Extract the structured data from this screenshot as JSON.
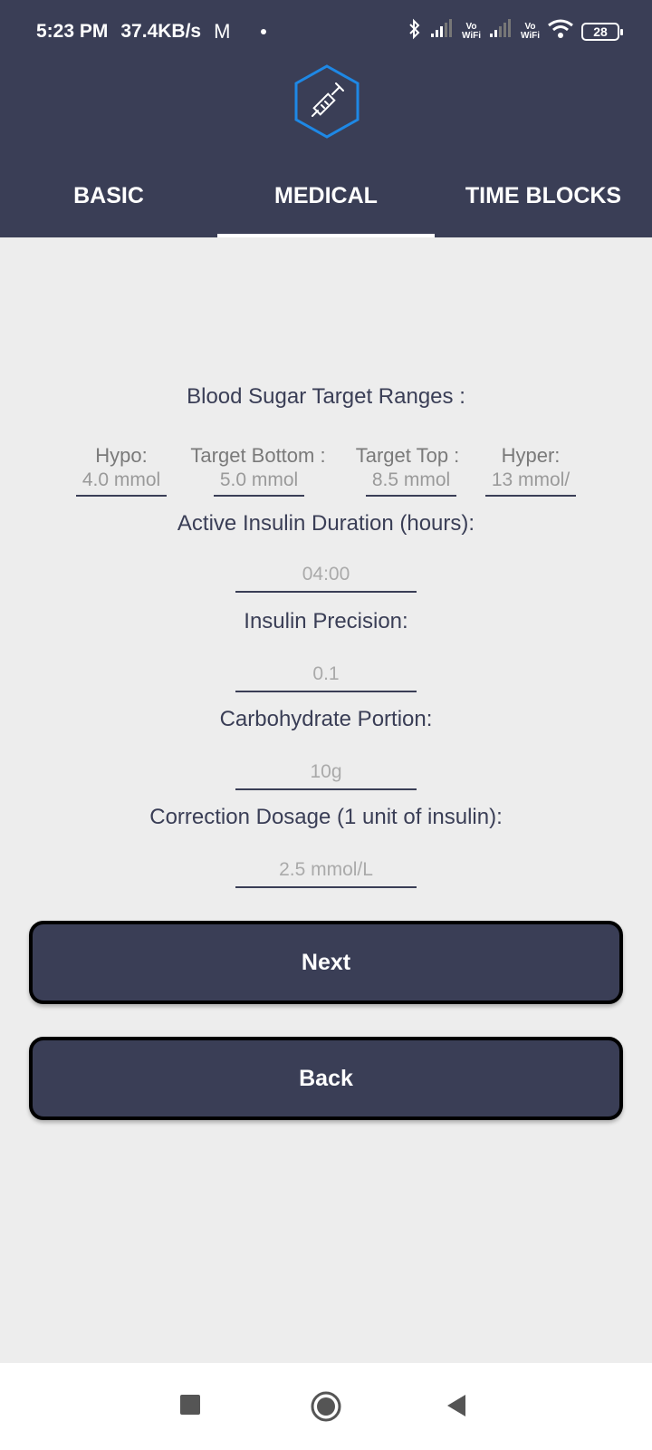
{
  "status_bar": {
    "time": "5:23 PM",
    "net_speed": "37.4KB/s",
    "mail_icon": "M",
    "vowifi_1_top": "Vo",
    "vowifi_1_bottom": "WiFi",
    "vowifi_2_top": "Vo",
    "vowifi_2_bottom": "WiFi",
    "battery": "28"
  },
  "header": {
    "logo_icon": "syringe-hexagon-icon",
    "accent_color": "#1e88e5",
    "background_color": "#3a3e56"
  },
  "tabs": [
    {
      "label": "BASIC",
      "active": false
    },
    {
      "label": "MEDICAL",
      "active": true
    },
    {
      "label": "TIME BLOCKS",
      "active": false
    }
  ],
  "form": {
    "ranges_title": "Blood Sugar Target Ranges :",
    "ranges": [
      {
        "label": "Hypo:",
        "value": "4.0 mmol"
      },
      {
        "label": "Target Bottom :",
        "value": "5.0 mmol"
      },
      {
        "label": "Target Top :",
        "value": "8.5 mmol"
      },
      {
        "label": "Hyper:",
        "value": "13 mmol/"
      }
    ],
    "active_insulin_label": "Active Insulin Duration (hours):",
    "active_insulin_value": "04:00",
    "precision_label": "Insulin Precision:",
    "precision_value": "0.1",
    "carb_label": "Carbohydrate Portion:",
    "carb_value": "10g",
    "correction_label": "Correction Dosage (1 unit of insulin):",
    "correction_value": "2.5 mmol/L"
  },
  "buttons": {
    "next": "Next",
    "back": "Back"
  },
  "nav": {
    "recent": "square-icon",
    "home": "circle-icon",
    "back": "triangle-back-icon"
  }
}
